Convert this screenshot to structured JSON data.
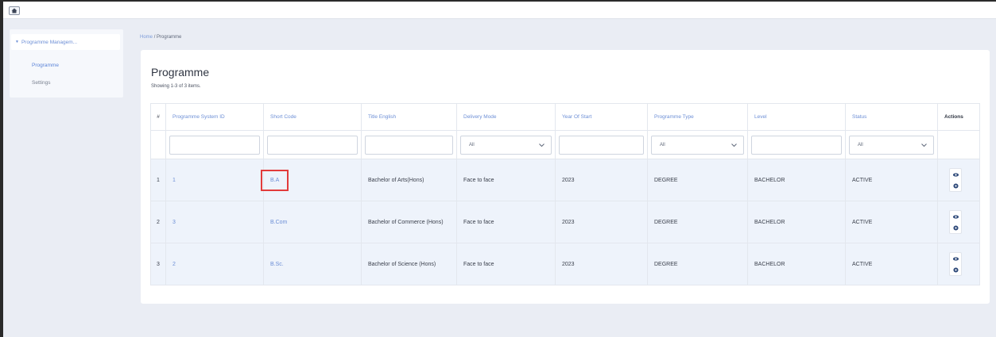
{
  "nav": {
    "home_icon": "home-icon"
  },
  "sidebar": {
    "group_label": "Programme Managem...",
    "items": [
      {
        "label": "Programme",
        "active": true
      },
      {
        "label": "Settings",
        "active": false
      }
    ]
  },
  "breadcrumb": {
    "home": "Home",
    "separator": "/",
    "current": "Programme"
  },
  "page": {
    "title": "Programme",
    "summary": "Showing 1-3 of 3 items."
  },
  "table": {
    "columns": [
      "#",
      "Programme System ID",
      "Short Code",
      "Title English",
      "Delivery Mode",
      "Year Of Start",
      "Programme Type",
      "Level",
      "Status",
      "Actions"
    ],
    "filters": {
      "delivery_mode": "All",
      "programme_type": "All",
      "status": "All"
    },
    "rows": [
      {
        "num": "1",
        "system_id": "1",
        "short_code": "B.A",
        "title": "Bachelor of Arts(Hons)",
        "delivery": "Face to face",
        "year": "2023",
        "type": "DEGREE",
        "level": "BACHELOR",
        "status": "ACTIVE",
        "highlighted": true
      },
      {
        "num": "2",
        "system_id": "3",
        "short_code": "B.Com",
        "title": "Bachelor of Commerce (Hons)",
        "delivery": "Face to face",
        "year": "2023",
        "type": "DEGREE",
        "level": "BACHELOR",
        "status": "ACTIVE",
        "highlighted": false
      },
      {
        "num": "3",
        "system_id": "2",
        "short_code": "B.Sc.",
        "title": "Bachelor of Science (Hons)",
        "delivery": "Face to face",
        "year": "2023",
        "type": "DEGREE",
        "level": "BACHELOR",
        "status": "ACTIVE",
        "highlighted": false
      }
    ],
    "action_icons": [
      "eye-icon",
      "gear-icon"
    ]
  },
  "colors": {
    "link": "#6d8fd6",
    "highlight": "#e23b3b",
    "row_bg": "#eef3fb",
    "page_bg": "#eaedf4"
  }
}
